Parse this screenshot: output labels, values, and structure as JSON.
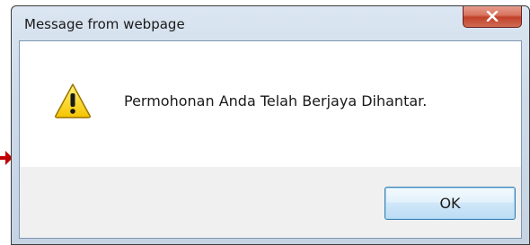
{
  "dialog": {
    "title": "Message from webpage",
    "message": "Permohonan Anda Telah Berjaya Dihantar.",
    "ok_label": "OK"
  },
  "icons": {
    "close": "close-icon",
    "warning": "warning-icon",
    "pointer": "arrow-pointer-icon"
  },
  "colors": {
    "close_button": "#c2412a",
    "warning_fill": "#f5c400",
    "ok_border": "#3c7fb1",
    "pointer_arrow": "#c00000"
  }
}
